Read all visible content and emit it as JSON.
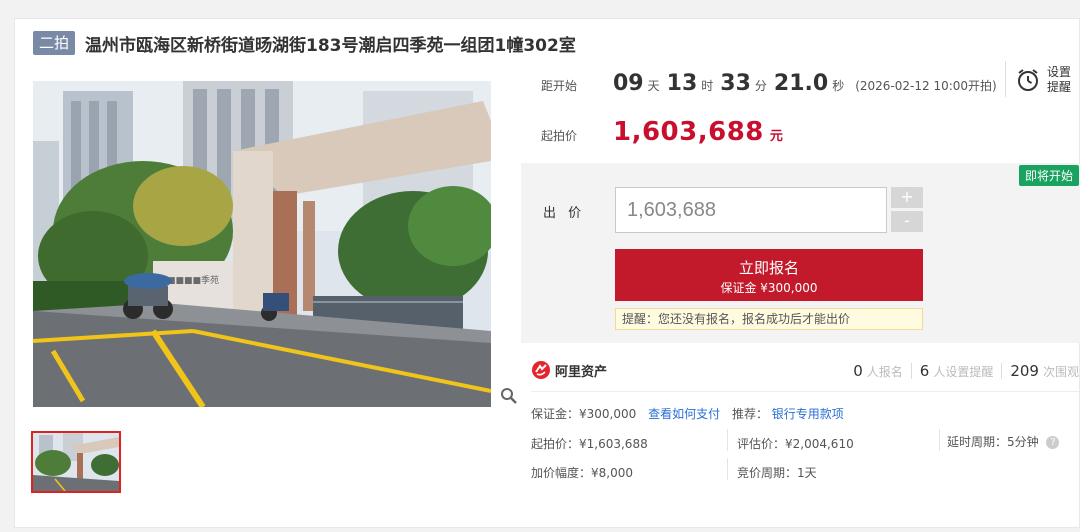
{
  "header": {
    "round_tag": "二拍",
    "title": "温州市瓯海区新桥街道旸湖街183号潮启四季苑一组团1幢302室"
  },
  "countdown": {
    "label": "距开始",
    "days": "09",
    "days_unit": "天",
    "hours": "13",
    "hours_unit": "时",
    "minutes": "33",
    "minutes_unit": "分",
    "seconds": "21.0",
    "seconds_unit": "秒",
    "start_note": "(2026-02-12 10:00开拍)"
  },
  "start_price": {
    "label": "起拍价",
    "value": "1,603,688",
    "unit": "元"
  },
  "reminder": {
    "label": "设置提醒",
    "icon": "alarm-clock-icon"
  },
  "bid": {
    "badge": "即将开始",
    "label": "出 价",
    "value": "1,603,688",
    "plus": "+",
    "minus": "-",
    "signup_label": "立即报名",
    "deposit_note": "保证金 ¥300,000",
    "tip": "提醒：您还没有报名，报名成功后才能出价"
  },
  "ali": {
    "brand": "阿里资产",
    "signup_count": "0",
    "signup_text": "人报名",
    "reminder_count": "6",
    "reminder_text": "人设置提醒",
    "view_count": "209",
    "view_text": "次围观"
  },
  "details": {
    "deposit": "保证金：¥300,000",
    "how_to_pay": "查看如何支付",
    "recommend_label": "推荐：",
    "recommend_link": "银行专用款项",
    "start_price": "起拍价：¥1,603,688",
    "appraisal": "评估价：¥2,004,610",
    "delay": "延时周期：5分钟",
    "increment": "加价幅度：¥8,000",
    "bid_cycle": "竞价周期：1天"
  },
  "colors": {
    "accent_red": "#c21a2a",
    "price_red": "#c8102e",
    "badge_green": "#1aa260",
    "link_blue": "#2a6fd1",
    "tag_gray": "#7a8aa6"
  }
}
